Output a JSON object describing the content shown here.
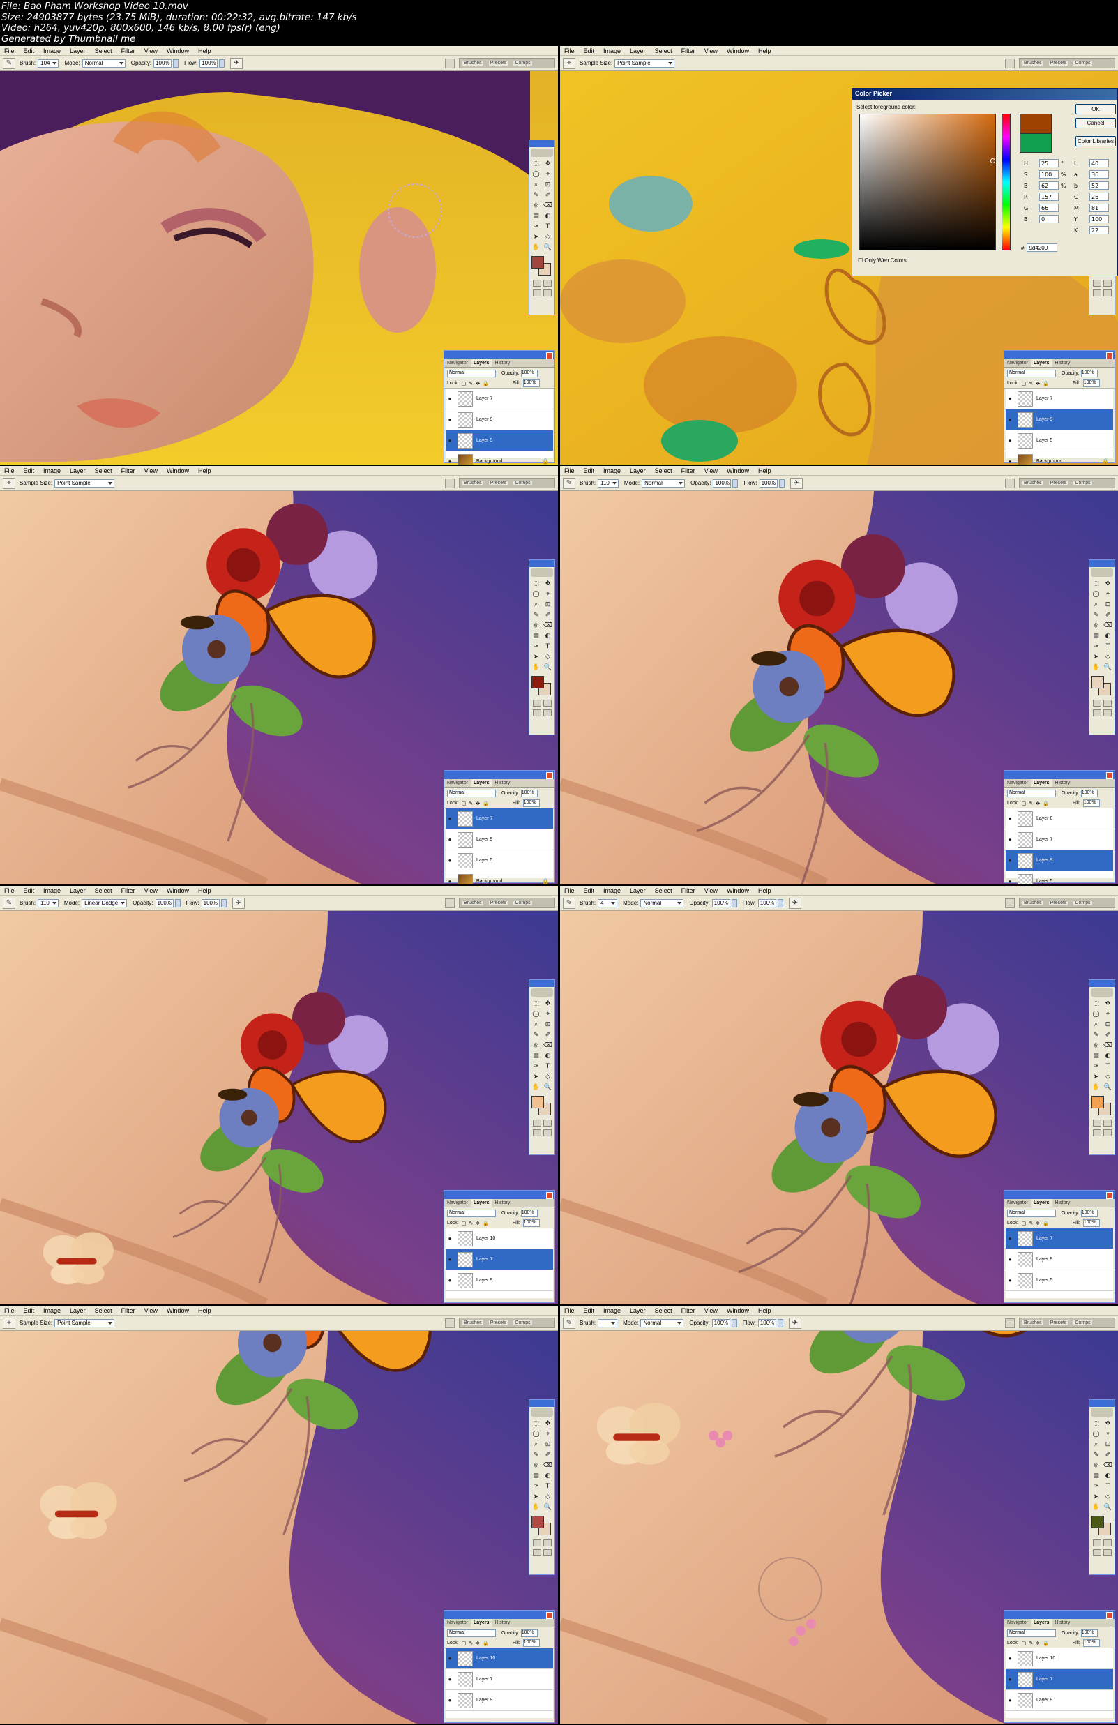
{
  "header": {
    "lines": [
      "File: Bao Pham Workshop Video 10.mov",
      "Size: 24903877 bytes (23.75 MiB), duration: 00:22:32, avg.bitrate: 147 kb/s",
      "Video: h264, yuv420p, 800x600, 146 kb/s,  8.00 fps(r) (eng)",
      "Generated by Thumbnail me"
    ]
  },
  "menu": [
    "File",
    "Edit",
    "Image",
    "Layer",
    "Select",
    "Filter",
    "View",
    "Window",
    "Help"
  ],
  "labels": {
    "brush": "Brush:",
    "mode": "Mode:",
    "opacity": "Opacity:",
    "flow": "Flow:",
    "sample_size": "Sample Size:",
    "normal": "Normal",
    "lock": "Lock:",
    "fill": "Fill:",
    "eye": "●"
  },
  "palette_tabs": [
    "Brushes",
    "Presets",
    "Comps"
  ],
  "layer_tabs": [
    "Navigator",
    "Layers",
    "History"
  ],
  "frames": [
    {
      "tool": "brush",
      "brush_size": "104",
      "mode": "Normal",
      "opacity": "100%",
      "flow": "100%",
      "timestamp": "",
      "fg_color": "#a0463c",
      "layer_opacity": "100%",
      "layer_fill": "100%",
      "layers": [
        {
          "name": "Layer 7",
          "active": false
        },
        {
          "name": "Layer 9",
          "active": false
        },
        {
          "name": "Layer 5",
          "active": true
        },
        {
          "name": "Background",
          "active": false,
          "bg": true
        }
      ]
    },
    {
      "tool": "eyedropper",
      "sample_size": "Point Sample",
      "timestamp": "",
      "fg_color": "#10a050",
      "layer_opacity": "100%",
      "layer_fill": "100%",
      "layers": [
        {
          "name": "Layer 7",
          "active": false
        },
        {
          "name": "Layer 9",
          "active": true
        },
        {
          "name": "Layer 5",
          "active": false
        },
        {
          "name": "Background",
          "active": false,
          "bg": true
        }
      ]
    },
    {
      "tool": "eyedropper",
      "sample_size": "Point Sample",
      "timestamp": "",
      "fg_color": "#8c1c10",
      "layer_opacity": "100%",
      "layer_fill": "100%",
      "layers": [
        {
          "name": "Layer 7",
          "active": true
        },
        {
          "name": "Layer 9",
          "active": false
        },
        {
          "name": "Layer 5",
          "active": false
        },
        {
          "name": "Background",
          "active": false,
          "bg": true
        }
      ]
    },
    {
      "tool": "brush",
      "brush_size": "110",
      "mode": "Normal",
      "opacity": "100%",
      "flow": "100%",
      "timestamp": "",
      "fg_color": "#e8d4bc",
      "layer_opacity": "100%",
      "layer_fill": "100%",
      "layers": [
        {
          "name": "Layer 8",
          "active": false
        },
        {
          "name": "Layer 7",
          "active": false
        },
        {
          "name": "Layer 9",
          "active": true
        },
        {
          "name": "Layer 5",
          "active": false
        }
      ]
    },
    {
      "tool": "brush",
      "brush_size": "110",
      "mode": "Linear Dodge",
      "opacity": "100%",
      "flow": "100%",
      "timestamp": "",
      "fg_color": "#f0c090",
      "layer_opacity": "100%",
      "layer_fill": "100%",
      "layers": [
        {
          "name": "Layer 10",
          "active": false
        },
        {
          "name": "Layer 7",
          "active": true
        },
        {
          "name": "Layer 9",
          "active": false
        }
      ]
    },
    {
      "tool": "brush",
      "brush_size": "4",
      "mode": "Normal",
      "opacity": "100%",
      "flow": "100%",
      "timestamp": "",
      "fg_color": "#f0a050",
      "layer_opacity": "100%",
      "layer_fill": "100%",
      "layers": [
        {
          "name": "Layer 7",
          "active": true
        },
        {
          "name": "Layer 9",
          "active": false
        },
        {
          "name": "Layer 5",
          "active": false
        }
      ]
    },
    {
      "tool": "eyedropper",
      "sample_size": "Point Sample",
      "timestamp": "",
      "fg_color": "#b04a44",
      "layer_opacity": "100%",
      "layer_fill": "100%",
      "layers": [
        {
          "name": "Layer 10",
          "active": true
        },
        {
          "name": "Layer 7",
          "active": false
        },
        {
          "name": "Layer 9",
          "active": false
        }
      ]
    },
    {
      "tool": "brush",
      "brush_size": "",
      "mode": "Normal",
      "opacity": "100%",
      "flow": "100%",
      "timestamp": "",
      "fg_color": "#4a5a14",
      "layer_opacity": "100%",
      "layer_fill": "100%",
      "layers": [
        {
          "name": "Layer 10",
          "active": false
        },
        {
          "name": "Layer 7",
          "active": true
        },
        {
          "name": "Layer 9",
          "active": false
        }
      ]
    }
  ],
  "color_picker": {
    "title": "Color Picker",
    "label": "Select foreground color:",
    "ok": "OK",
    "cancel": "Cancel",
    "libraries": "Color Libraries",
    "new_color": "#9d4200",
    "old_color": "#10a050",
    "values": {
      "H": "25",
      "H_unit": "°",
      "S": "100",
      "S_unit": "%",
      "B": "62",
      "B_unit": "%",
      "R": "157",
      "G": "66",
      "B2": "0",
      "L": "40",
      "a": "36",
      "b": "52",
      "C": "26",
      "M": "81",
      "Y": "100",
      "K": "22"
    },
    "web_only": "Only Web Colors",
    "hex_label": "#",
    "hex": "9d4200"
  }
}
